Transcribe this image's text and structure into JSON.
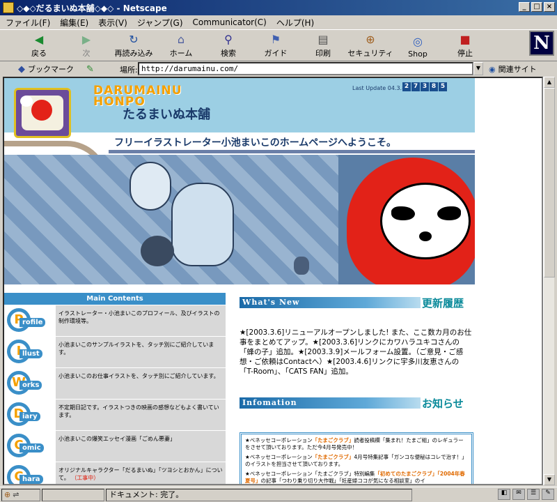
{
  "window": {
    "title": "◇◆◇だるまいぬ本舗◇◆◇ - Netscape"
  },
  "menu": [
    "ファイル(F)",
    "編集(E)",
    "表示(V)",
    "ジャンプ(G)",
    "Communicator(C)",
    "ヘルプ(H)"
  ],
  "toolbar": [
    {
      "label": "戻る",
      "icon": "back-arrow"
    },
    {
      "label": "次",
      "icon": "forward-arrow"
    },
    {
      "label": "再読み込み",
      "icon": "reload"
    },
    {
      "label": "ホーム",
      "icon": "home"
    },
    {
      "label": "検索",
      "icon": "search"
    },
    {
      "label": "ガイド",
      "icon": "guide"
    },
    {
      "label": "印刷",
      "icon": "print"
    },
    {
      "label": "セキュリティ",
      "icon": "lock"
    },
    {
      "label": "Shop",
      "icon": "shop"
    },
    {
      "label": "停止",
      "icon": "stop"
    }
  ],
  "logo_letter": "N",
  "location": {
    "bookmark_label": "ブックマーク",
    "label": "場所:",
    "url": "http://darumainu.com/",
    "related_label": "関連サイト"
  },
  "page": {
    "logo_en_line1": "DARUMAINU",
    "logo_en_line2": "HONPO",
    "logo_jp": "たるまいぬ本舗",
    "last_update_label": "Last Update 04.3.8",
    "update_digits": [
      "2",
      "7",
      "3",
      "8",
      "5"
    ],
    "welcome": "フリーイラストレーター小池まいこのホームページへようこそ。",
    "sidebar": {
      "heading": "Main Contents",
      "items": [
        {
          "letter": "P",
          "word": "rofile",
          "desc": "イラストレーター・小池まいこのプロフィール、及びイラストの制作環境等。",
          "badge": ""
        },
        {
          "letter": "I",
          "word": "llust",
          "desc": "小池まいこのサンプルイラストを、タッチ別にご紹介しています。",
          "badge": ""
        },
        {
          "letter": "W",
          "word": "orks",
          "desc": "小池まいこのお仕事イラストを、タッチ別にご紹介しています。",
          "badge": ""
        },
        {
          "letter": "D",
          "word": "iary",
          "desc": "不定期日記です。イラストつきの映画の感想などもよく書いています。",
          "badge": ""
        },
        {
          "letter": "C",
          "word": "omic",
          "desc": "小池まいこの爆笑エッセイ漫画「ごめん悪妻」",
          "badge": ""
        },
        {
          "letter": "C",
          "word": "hara",
          "desc": "オリジナルキャラクター「だるまいぬ」「ツヨシとおかん」について。",
          "badge": "（工事中）"
        }
      ]
    },
    "news": {
      "label": "What's New",
      "label_jp": "更新履歴",
      "body": "★[2003.3.6]リニューアルオープンしました! また、ここ数カ月のお仕事をまとめてアップ。★[2003.3.6]リンクにカワハラユキコさんの「蜂の子」追加。★[2003.3.9]メールフォーム設置。（ご意見・ご感想・ご依頼はContactへ）★[2003.4.6]リンクに宇多川友恵さんの「T-Room」、「CATS FAN」追加。"
    },
    "info": {
      "label": "Infomation",
      "label_jp": "お知らせ",
      "entries": [
        {
          "pre": "★ベネッセコーポレーション",
          "hl": "「たまごクラブ」",
          "post": "読者投稿欄「集まれ！たまご組」のレギュラーをさせて頂いております。ただ今4月号発売中！"
        },
        {
          "pre": "★ベネッセコーポレーション",
          "hl": "「たまごクラブ」",
          "post": "4月号特集記事「ガンコな便秘はコレで治す！」のイラストを担当させて頂いております。"
        },
        {
          "pre": "★ベネッセコーポレーション「たまごクラブ」特別編集",
          "hl": "「初めてのたまごクラブ」「2004年春夏号」",
          "post": "の記事「つわり乗り切り大作戦」「妊産婦ココが気になる相談室」のイ"
        }
      ]
    }
  },
  "status": {
    "text": "ドキュメント: 完了。"
  }
}
